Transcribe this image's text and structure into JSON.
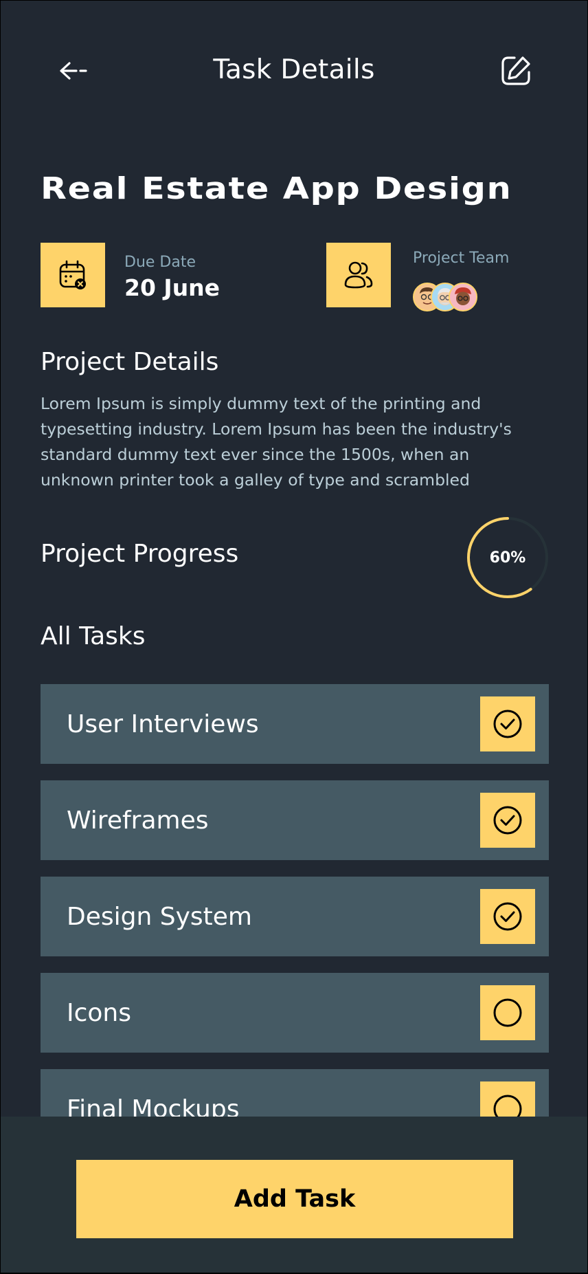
{
  "header": {
    "title": "Task Details",
    "back_icon": "arrow-left-icon",
    "edit_icon": "edit-icon"
  },
  "project": {
    "title": "Real Estate App Design",
    "due_date": {
      "label": "Due Date",
      "value": "20 June",
      "icon": "calendar-icon"
    },
    "team": {
      "label": "Project Team",
      "icon": "users-icon",
      "avatars": [
        "avatar-1",
        "avatar-2",
        "avatar-3"
      ]
    }
  },
  "details": {
    "heading": "Project Details",
    "text": "Lorem Ipsum is simply dummy text of the printing and typesetting industry. Lorem Ipsum has been the industry's standard dummy text ever since the 1500s, when an unknown printer took a galley of type and scrambled"
  },
  "progress": {
    "heading": "Project Progress",
    "label": "60%",
    "fraction": 0.6
  },
  "tasks": {
    "heading": "All Tasks",
    "items": [
      {
        "label": "User Interviews",
        "done": true
      },
      {
        "label": "Wireframes",
        "done": true
      },
      {
        "label": "Design System",
        "done": true
      },
      {
        "label": "Icons",
        "done": false
      },
      {
        "label": "Final Mockups",
        "done": false
      }
    ]
  },
  "footer": {
    "add_task_label": "Add Task"
  },
  "colors": {
    "background": "#212832",
    "accent": "#FED36A",
    "task_row": "#455A64",
    "bottom_bar": "#263238",
    "muted_text": "#8CAAB9"
  }
}
